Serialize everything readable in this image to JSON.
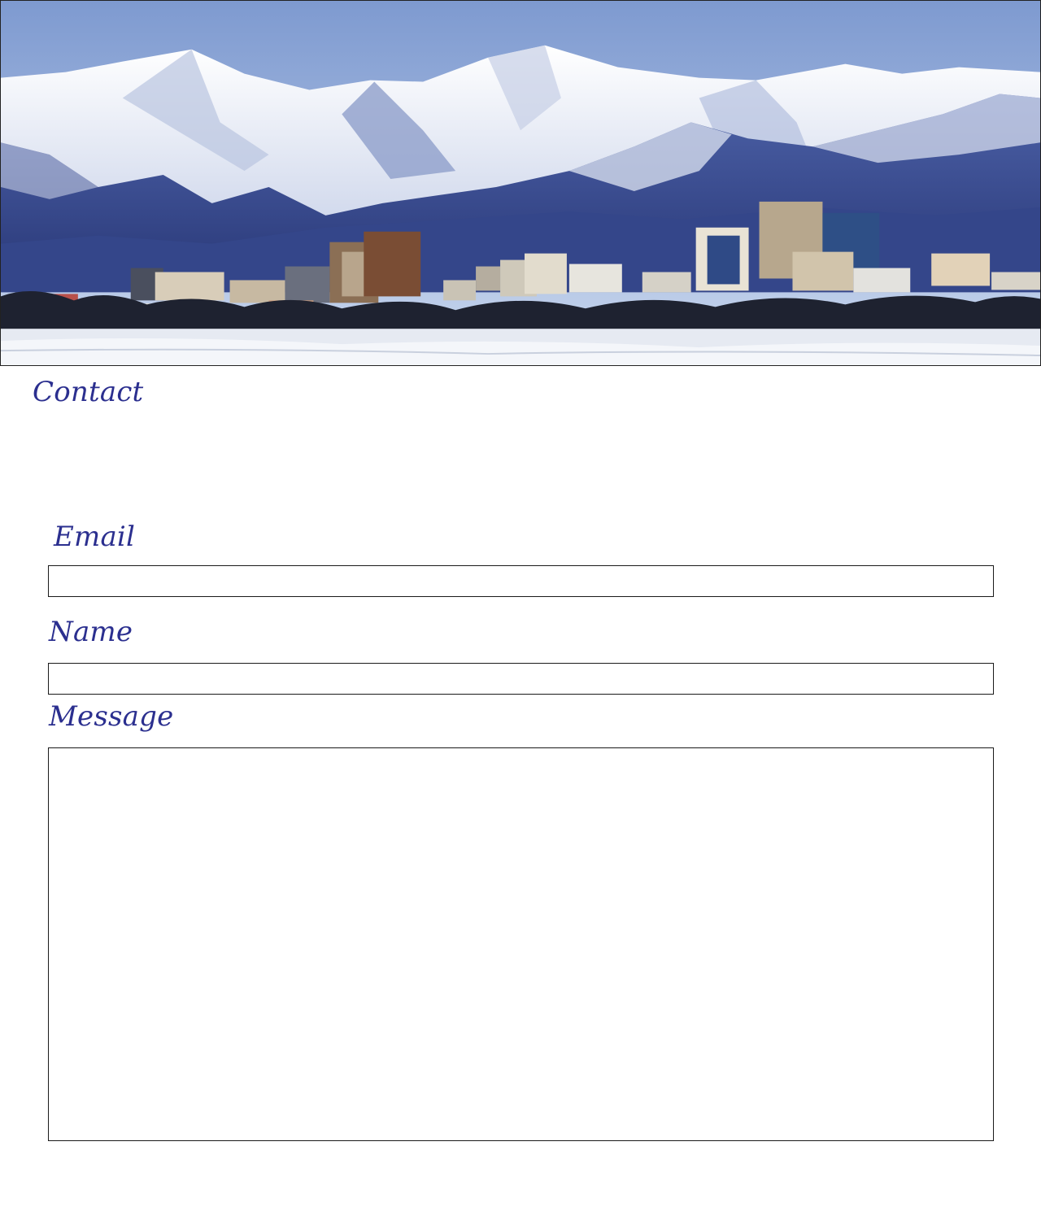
{
  "hero": {
    "image_name": "anchorage-skyline-mountains-image",
    "colors": {
      "sky": "#8ea8d6",
      "snow": "#eef1f8",
      "mountain_shadow": "#3b4f93",
      "foothills": "#2f3f80",
      "ice": "#e9edf4"
    }
  },
  "page": {
    "title": "Contact"
  },
  "form": {
    "email": {
      "label": "Email",
      "value": "",
      "placeholder": ""
    },
    "name": {
      "label": "Name",
      "value": "",
      "placeholder": ""
    },
    "message": {
      "label": "Message",
      "value": "",
      "placeholder": ""
    }
  },
  "theme": {
    "heading_color": "#2b2f8f",
    "field_border": "#1a1a1a"
  }
}
